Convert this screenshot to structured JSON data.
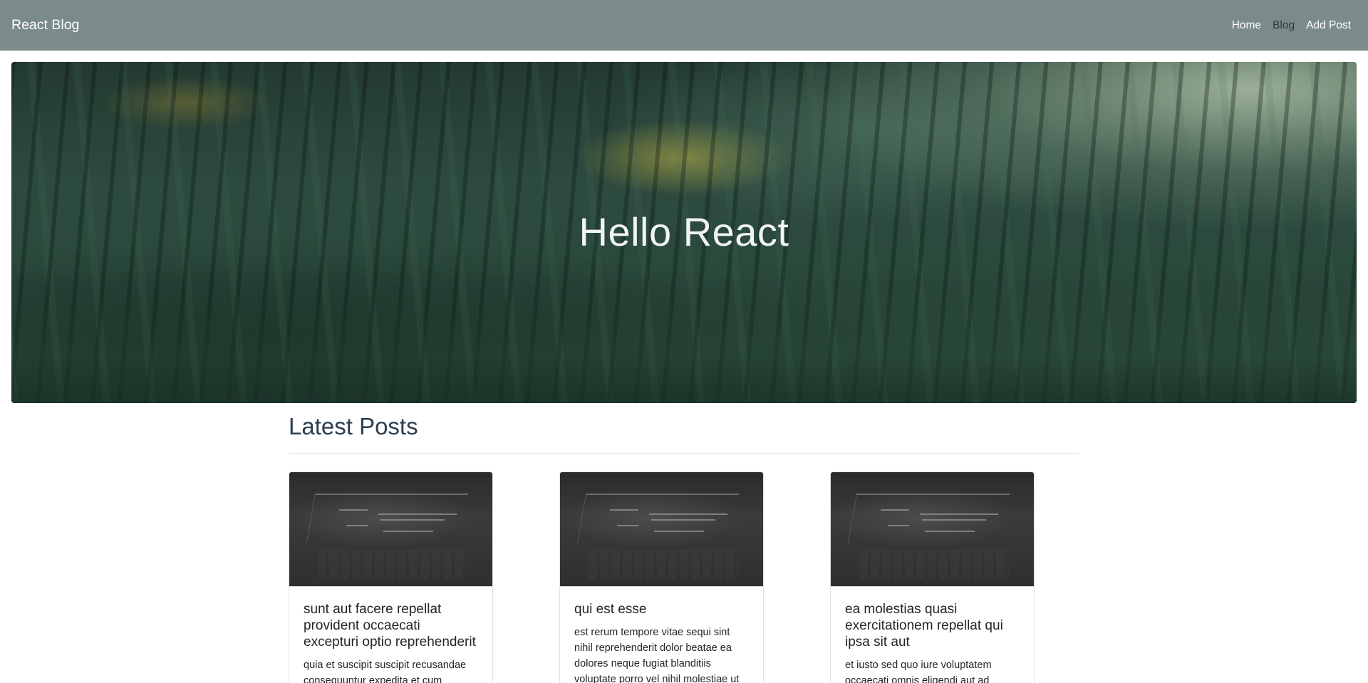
{
  "navbar": {
    "brand": "React Blog",
    "links": [
      {
        "label": "Home",
        "active": false
      },
      {
        "label": "Blog",
        "active": true
      },
      {
        "label": "Add Post",
        "active": false
      }
    ],
    "bg_color": "#7b8a8b"
  },
  "hero": {
    "title": "Hello React"
  },
  "main": {
    "section_title": "Latest Posts",
    "posts": [
      {
        "title": "sunt aut facere repellat provident occaecati excepturi optio reprehenderit",
        "body": "quia et suscipit suscipit recusandae consequuntur expedita et cum"
      },
      {
        "title": "qui est esse",
        "body": "est rerum tempore vitae sequi sint nihil reprehenderit dolor beatae ea dolores neque fugiat blanditiis voluptate porro vel nihil molestiae ut"
      },
      {
        "title": "ea molestias quasi exercitationem repellat qui ipsa sit aut",
        "body": "et iusto sed quo iure voluptatem occaecati omnis eligendi aut ad"
      }
    ]
  }
}
